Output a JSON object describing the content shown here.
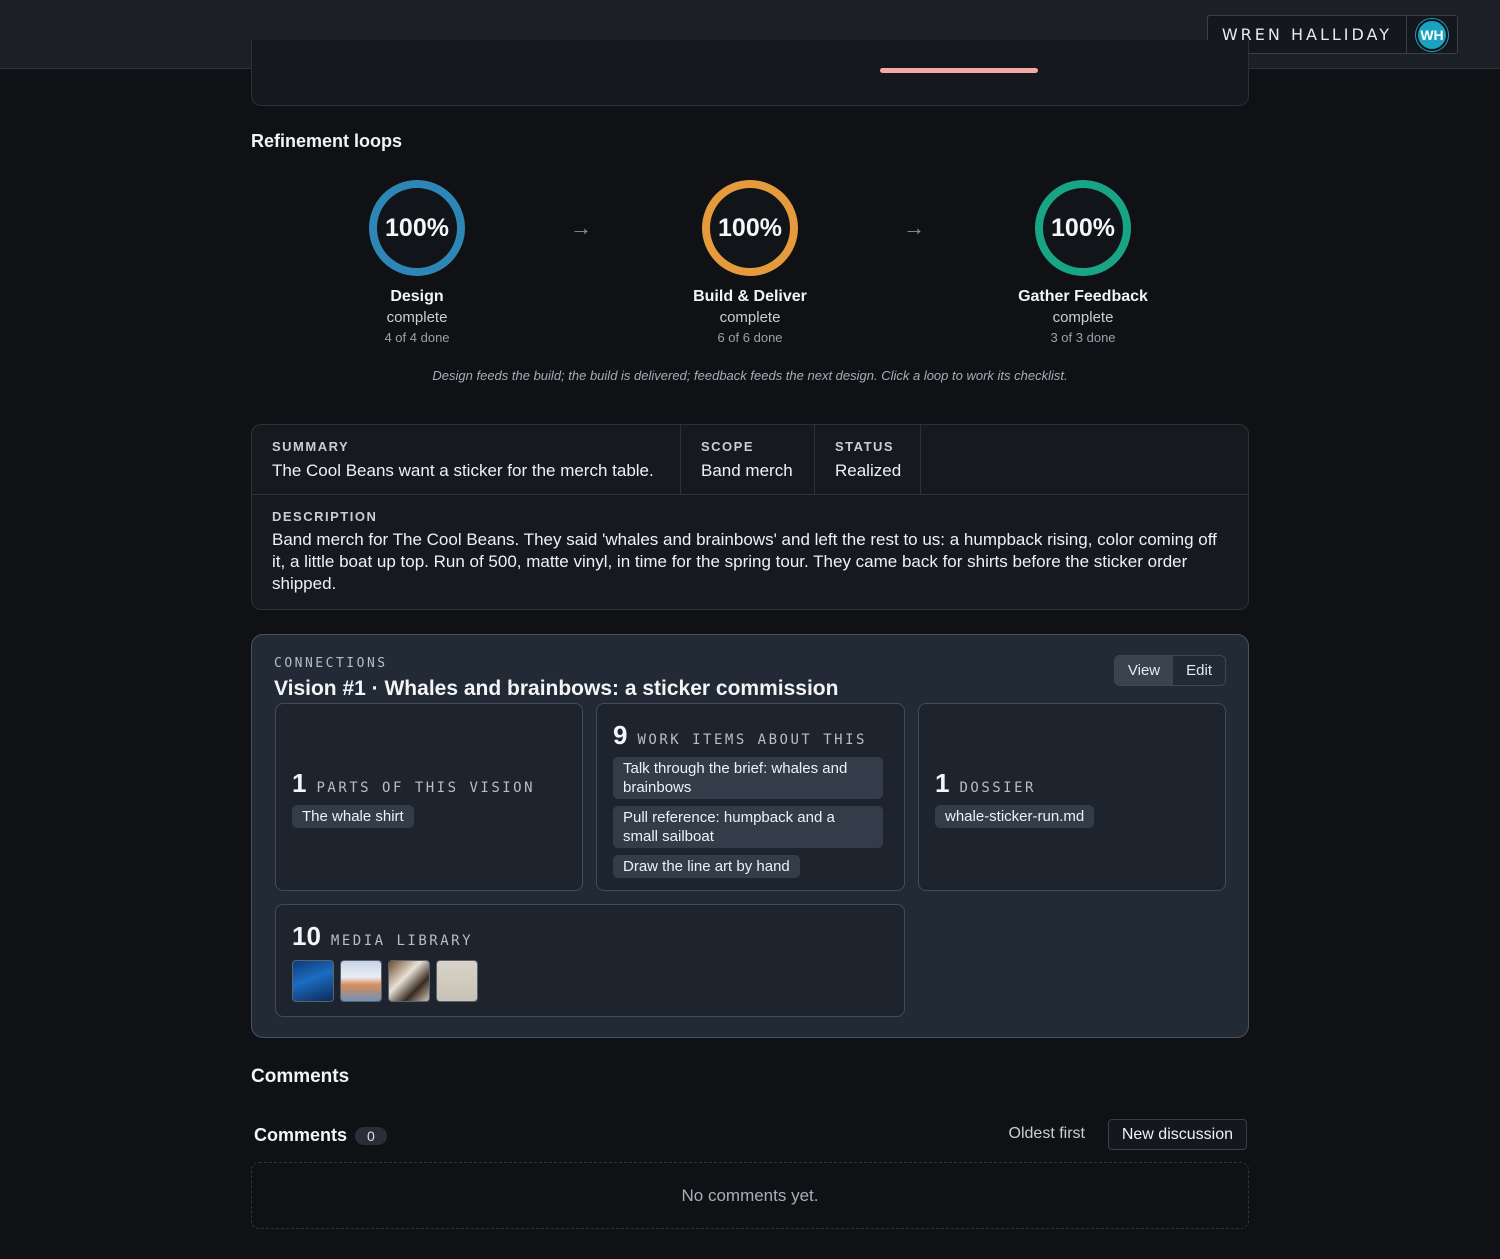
{
  "header": {
    "user_name": "WREN HALLIDAY",
    "avatar_initials": "WH"
  },
  "refinement": {
    "title": "Refinement loops",
    "loops": [
      {
        "percent": "100%",
        "progress": 1.0,
        "name": "Design",
        "status": "complete",
        "done": "4 of 4 done",
        "color": "#2e86b6"
      },
      {
        "percent": "100%",
        "progress": 1.0,
        "name": "Build & Deliver",
        "status": "complete",
        "done": "6 of 6 done",
        "color": "#e59a3b"
      },
      {
        "percent": "100%",
        "progress": 1.0,
        "name": "Gather Feedback",
        "status": "complete",
        "done": "3 of 3 done",
        "color": "#18a585"
      }
    ],
    "arrow": "→",
    "caption": "Design feeds the build; the build is delivered; feedback feeds the next design. Click a loop to work its checklist."
  },
  "summary": {
    "summary_label": "SUMMARY",
    "summary_value": "The Cool Beans want a sticker for the merch table.",
    "scope_label": "SCOPE",
    "scope_value": "Band merch",
    "status_label": "STATUS",
    "status_value": "Realized",
    "description_label": "DESCRIPTION",
    "description_value": "Band merch for The Cool Beans. They said 'whales and brainbows' and left the rest to us: a humpback rising, color coming off it, a little boat up top. Run of 500, matte vinyl, in time for the spring tour. They came back for shirts before the sticker order shipped."
  },
  "connections": {
    "label": "CONNECTIONS",
    "title": "Vision #1 · Whales and brainbows: a sticker commission",
    "view_label": "View",
    "edit_label": "Edit",
    "parts": {
      "count": "1",
      "kind": "PARTS OF THIS VISION",
      "items": [
        "The whale shirt"
      ]
    },
    "work_items": {
      "count": "9",
      "kind": "WORK ITEMS ABOUT THIS",
      "items": [
        "Talk through the brief: whales and brainbows",
        "Pull reference: humpback and a small sailboat",
        "Draw the line art by hand"
      ]
    },
    "dossier": {
      "count": "1",
      "kind": "DOSSIER",
      "items": [
        "whale-sticker-run.md"
      ]
    },
    "media": {
      "count": "10",
      "kind": "MEDIA LIBRARY",
      "thumb_count_shown": 4
    }
  },
  "comments": {
    "section_title": "Comments",
    "title": "Comments",
    "count": "0",
    "sort_label": "Oldest first",
    "new_label": "New discussion",
    "empty_text": "No comments yet."
  }
}
